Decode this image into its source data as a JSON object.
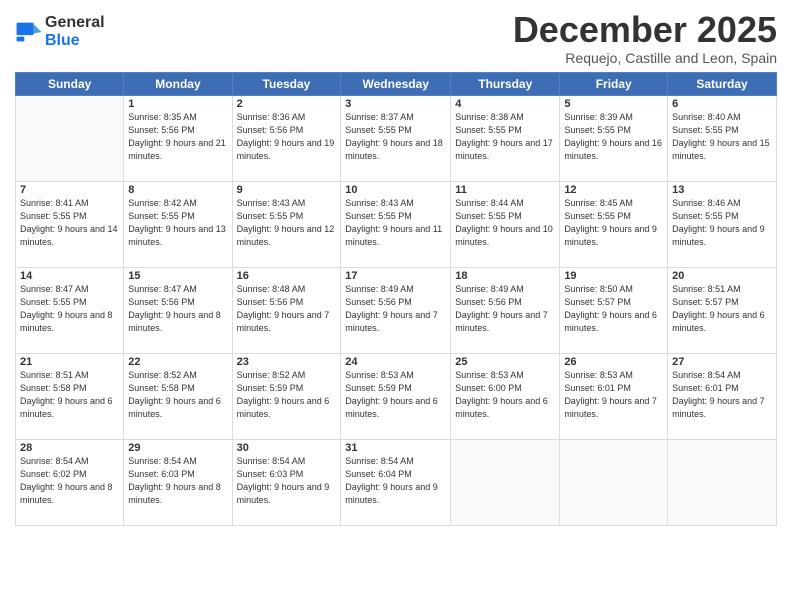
{
  "header": {
    "logo_line1": "General",
    "logo_line2": "Blue",
    "month": "December 2025",
    "location": "Requejo, Castille and Leon, Spain"
  },
  "weekdays": [
    "Sunday",
    "Monday",
    "Tuesday",
    "Wednesday",
    "Thursday",
    "Friday",
    "Saturday"
  ],
  "weeks": [
    [
      {
        "day": "",
        "sunrise": "",
        "sunset": "",
        "daylight": ""
      },
      {
        "day": "1",
        "sunrise": "Sunrise: 8:35 AM",
        "sunset": "Sunset: 5:56 PM",
        "daylight": "Daylight: 9 hours and 21 minutes."
      },
      {
        "day": "2",
        "sunrise": "Sunrise: 8:36 AM",
        "sunset": "Sunset: 5:56 PM",
        "daylight": "Daylight: 9 hours and 19 minutes."
      },
      {
        "day": "3",
        "sunrise": "Sunrise: 8:37 AM",
        "sunset": "Sunset: 5:55 PM",
        "daylight": "Daylight: 9 hours and 18 minutes."
      },
      {
        "day": "4",
        "sunrise": "Sunrise: 8:38 AM",
        "sunset": "Sunset: 5:55 PM",
        "daylight": "Daylight: 9 hours and 17 minutes."
      },
      {
        "day": "5",
        "sunrise": "Sunrise: 8:39 AM",
        "sunset": "Sunset: 5:55 PM",
        "daylight": "Daylight: 9 hours and 16 minutes."
      },
      {
        "day": "6",
        "sunrise": "Sunrise: 8:40 AM",
        "sunset": "Sunset: 5:55 PM",
        "daylight": "Daylight: 9 hours and 15 minutes."
      }
    ],
    [
      {
        "day": "7",
        "sunrise": "Sunrise: 8:41 AM",
        "sunset": "Sunset: 5:55 PM",
        "daylight": "Daylight: 9 hours and 14 minutes."
      },
      {
        "day": "8",
        "sunrise": "Sunrise: 8:42 AM",
        "sunset": "Sunset: 5:55 PM",
        "daylight": "Daylight: 9 hours and 13 minutes."
      },
      {
        "day": "9",
        "sunrise": "Sunrise: 8:43 AM",
        "sunset": "Sunset: 5:55 PM",
        "daylight": "Daylight: 9 hours and 12 minutes."
      },
      {
        "day": "10",
        "sunrise": "Sunrise: 8:43 AM",
        "sunset": "Sunset: 5:55 PM",
        "daylight": "Daylight: 9 hours and 11 minutes."
      },
      {
        "day": "11",
        "sunrise": "Sunrise: 8:44 AM",
        "sunset": "Sunset: 5:55 PM",
        "daylight": "Daylight: 9 hours and 10 minutes."
      },
      {
        "day": "12",
        "sunrise": "Sunrise: 8:45 AM",
        "sunset": "Sunset: 5:55 PM",
        "daylight": "Daylight: 9 hours and 9 minutes."
      },
      {
        "day": "13",
        "sunrise": "Sunrise: 8:46 AM",
        "sunset": "Sunset: 5:55 PM",
        "daylight": "Daylight: 9 hours and 9 minutes."
      }
    ],
    [
      {
        "day": "14",
        "sunrise": "Sunrise: 8:47 AM",
        "sunset": "Sunset: 5:55 PM",
        "daylight": "Daylight: 9 hours and 8 minutes."
      },
      {
        "day": "15",
        "sunrise": "Sunrise: 8:47 AM",
        "sunset": "Sunset: 5:56 PM",
        "daylight": "Daylight: 9 hours and 8 minutes."
      },
      {
        "day": "16",
        "sunrise": "Sunrise: 8:48 AM",
        "sunset": "Sunset: 5:56 PM",
        "daylight": "Daylight: 9 hours and 7 minutes."
      },
      {
        "day": "17",
        "sunrise": "Sunrise: 8:49 AM",
        "sunset": "Sunset: 5:56 PM",
        "daylight": "Daylight: 9 hours and 7 minutes."
      },
      {
        "day": "18",
        "sunrise": "Sunrise: 8:49 AM",
        "sunset": "Sunset: 5:56 PM",
        "daylight": "Daylight: 9 hours and 7 minutes."
      },
      {
        "day": "19",
        "sunrise": "Sunrise: 8:50 AM",
        "sunset": "Sunset: 5:57 PM",
        "daylight": "Daylight: 9 hours and 6 minutes."
      },
      {
        "day": "20",
        "sunrise": "Sunrise: 8:51 AM",
        "sunset": "Sunset: 5:57 PM",
        "daylight": "Daylight: 9 hours and 6 minutes."
      }
    ],
    [
      {
        "day": "21",
        "sunrise": "Sunrise: 8:51 AM",
        "sunset": "Sunset: 5:58 PM",
        "daylight": "Daylight: 9 hours and 6 minutes."
      },
      {
        "day": "22",
        "sunrise": "Sunrise: 8:52 AM",
        "sunset": "Sunset: 5:58 PM",
        "daylight": "Daylight: 9 hours and 6 minutes."
      },
      {
        "day": "23",
        "sunrise": "Sunrise: 8:52 AM",
        "sunset": "Sunset: 5:59 PM",
        "daylight": "Daylight: 9 hours and 6 minutes."
      },
      {
        "day": "24",
        "sunrise": "Sunrise: 8:53 AM",
        "sunset": "Sunset: 5:59 PM",
        "daylight": "Daylight: 9 hours and 6 minutes."
      },
      {
        "day": "25",
        "sunrise": "Sunrise: 8:53 AM",
        "sunset": "Sunset: 6:00 PM",
        "daylight": "Daylight: 9 hours and 6 minutes."
      },
      {
        "day": "26",
        "sunrise": "Sunrise: 8:53 AM",
        "sunset": "Sunset: 6:01 PM",
        "daylight": "Daylight: 9 hours and 7 minutes."
      },
      {
        "day": "27",
        "sunrise": "Sunrise: 8:54 AM",
        "sunset": "Sunset: 6:01 PM",
        "daylight": "Daylight: 9 hours and 7 minutes."
      }
    ],
    [
      {
        "day": "28",
        "sunrise": "Sunrise: 8:54 AM",
        "sunset": "Sunset: 6:02 PM",
        "daylight": "Daylight: 9 hours and 8 minutes."
      },
      {
        "day": "29",
        "sunrise": "Sunrise: 8:54 AM",
        "sunset": "Sunset: 6:03 PM",
        "daylight": "Daylight: 9 hours and 8 minutes."
      },
      {
        "day": "30",
        "sunrise": "Sunrise: 8:54 AM",
        "sunset": "Sunset: 6:03 PM",
        "daylight": "Daylight: 9 hours and 9 minutes."
      },
      {
        "day": "31",
        "sunrise": "Sunrise: 8:54 AM",
        "sunset": "Sunset: 6:04 PM",
        "daylight": "Daylight: 9 hours and 9 minutes."
      },
      {
        "day": "",
        "sunrise": "",
        "sunset": "",
        "daylight": ""
      },
      {
        "day": "",
        "sunrise": "",
        "sunset": "",
        "daylight": ""
      },
      {
        "day": "",
        "sunrise": "",
        "sunset": "",
        "daylight": ""
      }
    ]
  ]
}
